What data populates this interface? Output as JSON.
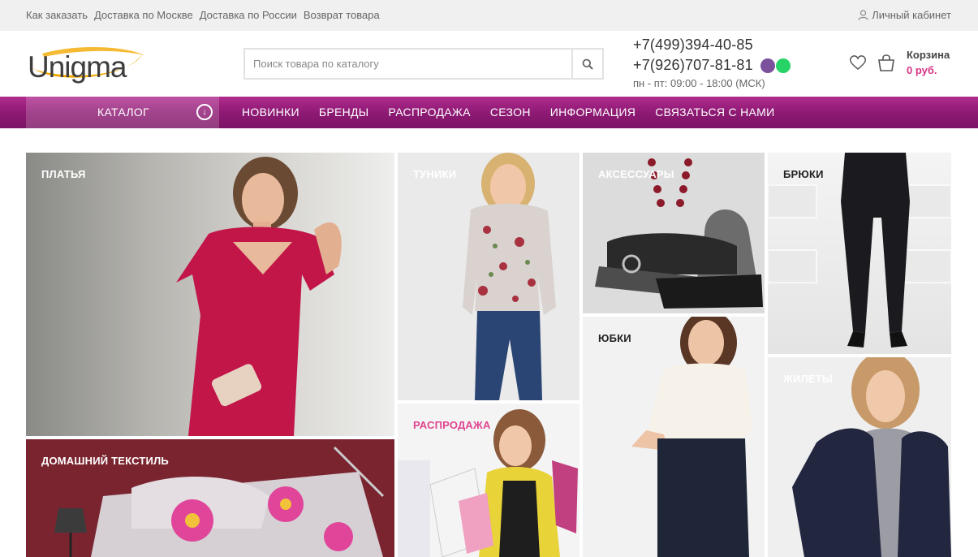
{
  "topbar": {
    "links": [
      "Как заказать",
      "Доставка по Москве",
      "Доставка по России",
      "Возврат товара"
    ],
    "account": "Личный кабинет"
  },
  "header": {
    "logo_text": "Unigma",
    "search_placeholder": "Поиск товара по каталогу",
    "phone1": "+7(499)394-40-85",
    "phone2": "+7(926)707-81-81",
    "hours": "пн - пт: 09:00 - 18:00 (МСК)",
    "cart_label": "Корзина",
    "cart_sum": "0 руб."
  },
  "nav": {
    "catalog": "КАТАЛОГ",
    "items": [
      "НОВИНКИ",
      "БРЕНДЫ",
      "РАСПРОДАЖА",
      "СЕЗОН",
      "ИНФОРМАЦИЯ",
      "СВЯЗАТЬСЯ С НАМИ"
    ]
  },
  "categories": {
    "dresses": "ПЛАТЬЯ",
    "tunics": "ТУНИКИ",
    "accessories": "АКСЕССУАРЫ",
    "trousers": "БРЮКИ",
    "skirts": "ЮБКИ",
    "vests": "ЖИЛЕТЫ",
    "textile": "ДОМАШНИЙ ТЕКСТИЛЬ",
    "sale": "РАСПРОДАЖА"
  },
  "colors": {
    "brand": "#8e1a74",
    "accent": "#d63384",
    "sale_label": "#e0468f"
  }
}
